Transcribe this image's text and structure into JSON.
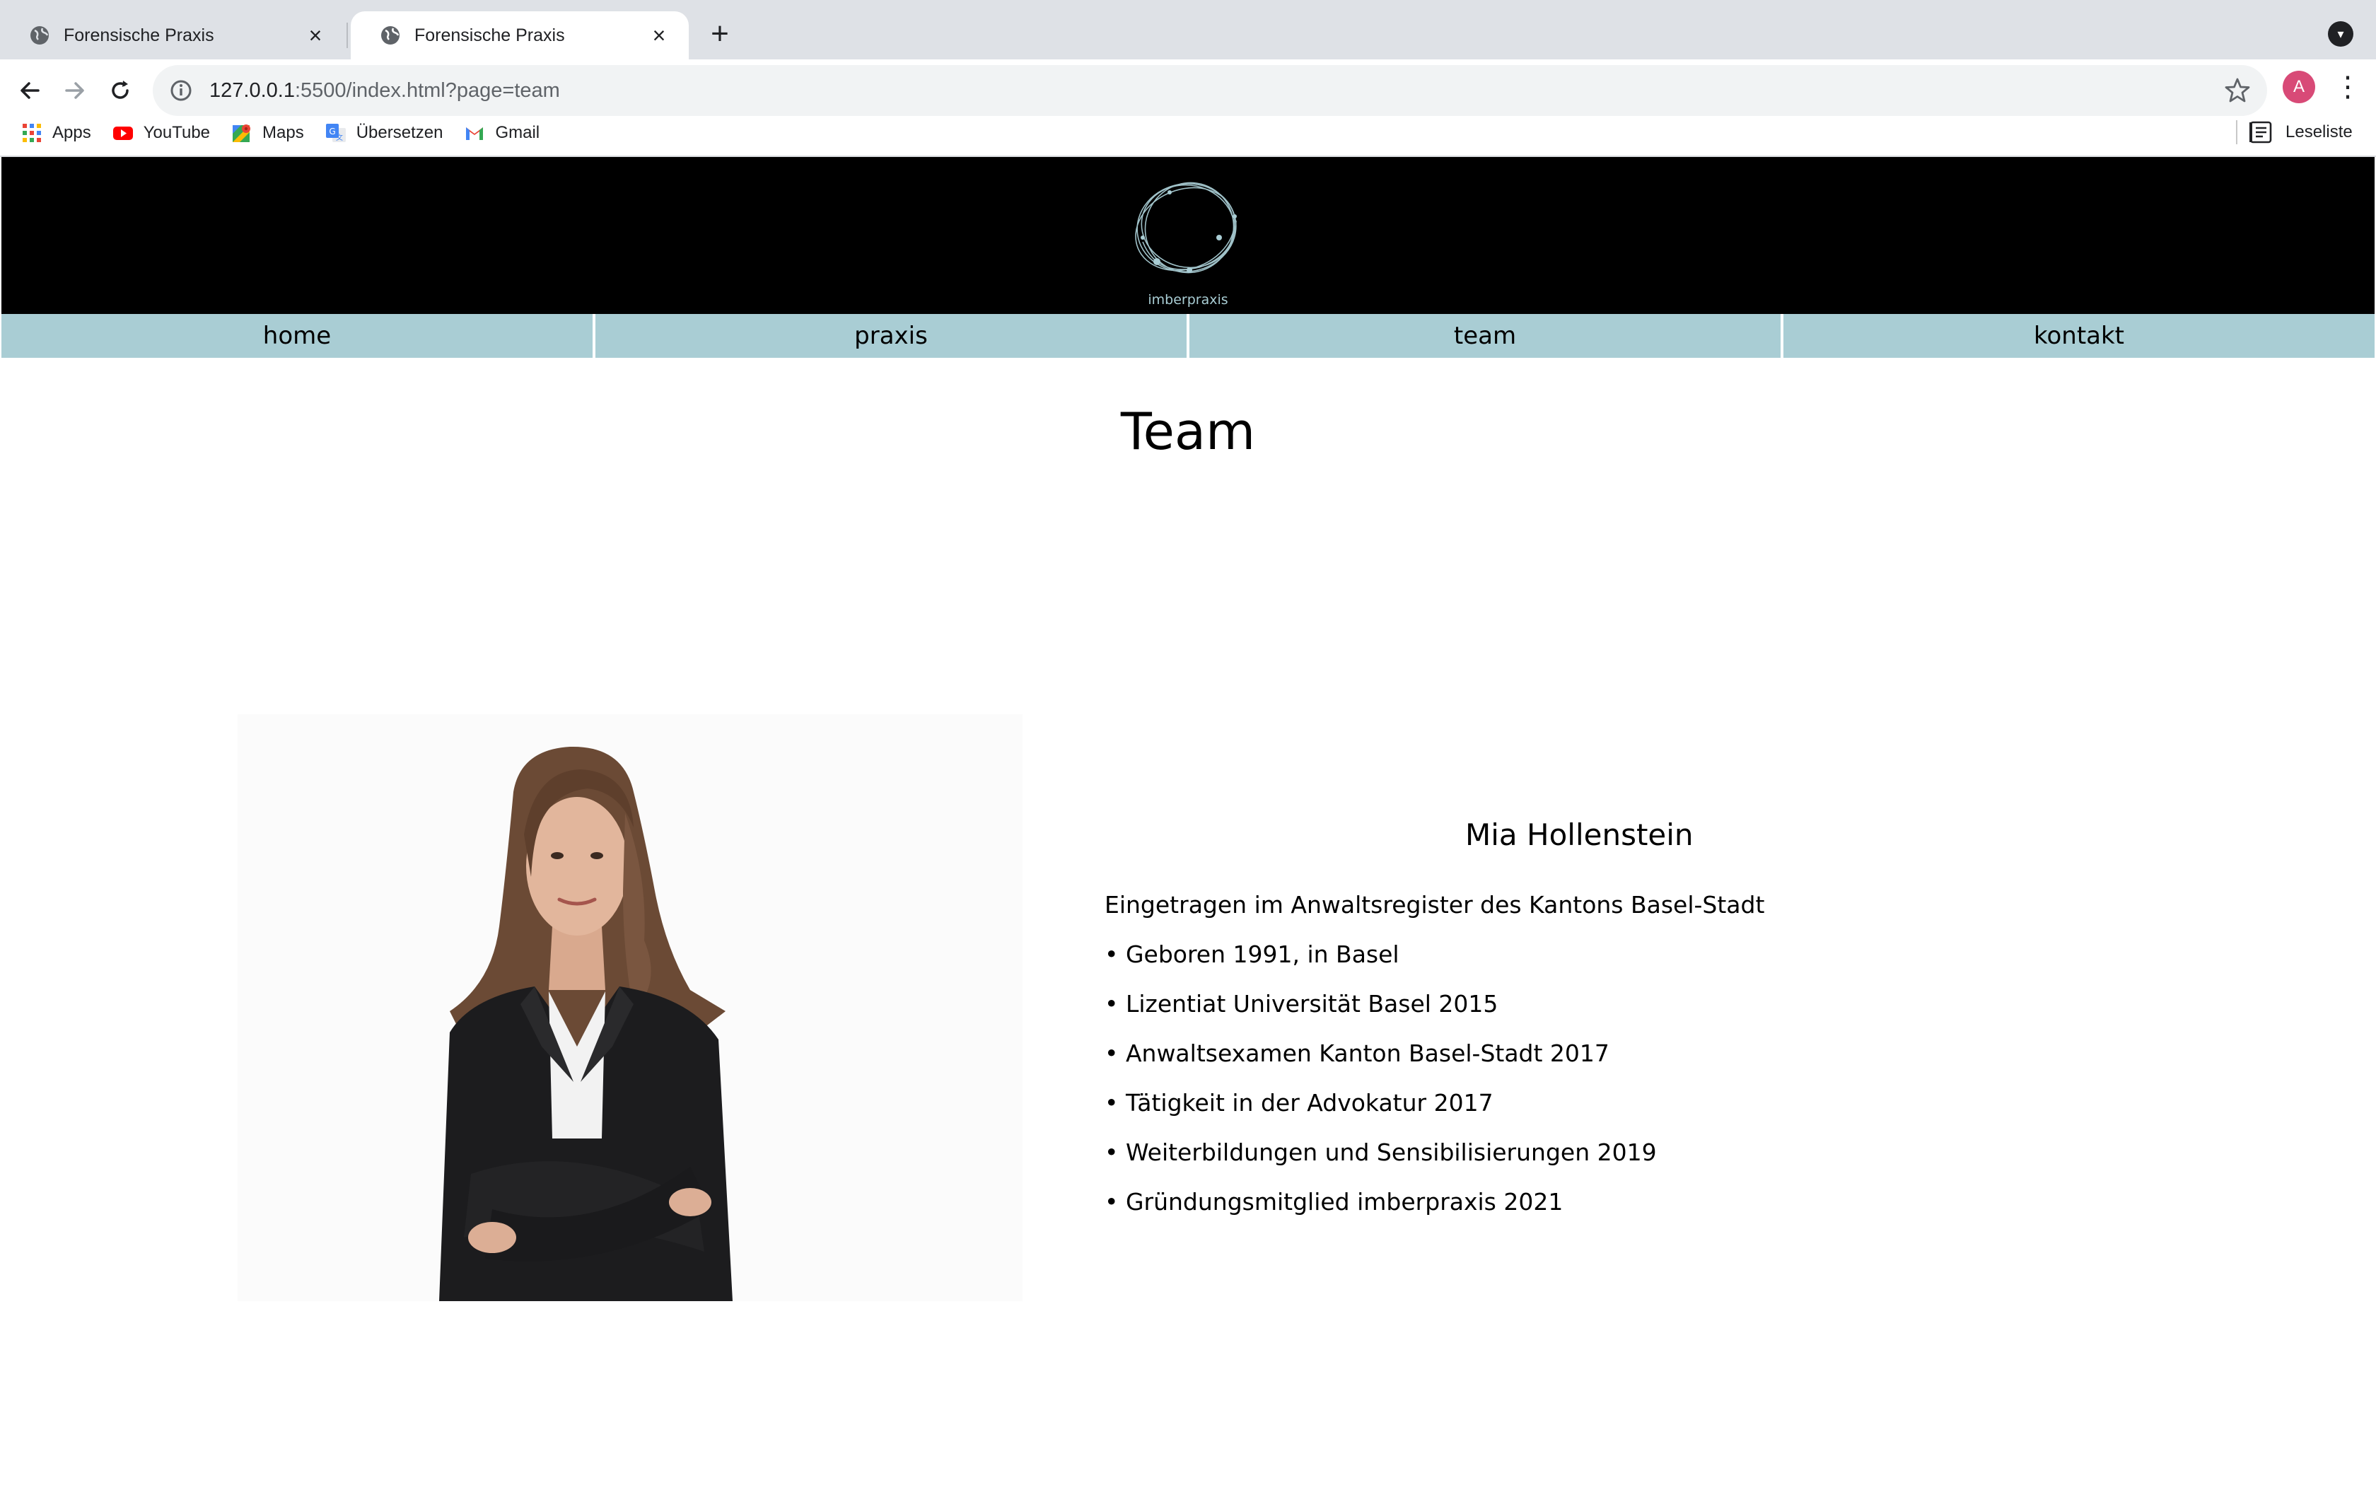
{
  "browser": {
    "tabs": [
      {
        "title": "Forensische Praxis",
        "active": false
      },
      {
        "title": "Forensische Praxis",
        "active": true
      }
    ],
    "new_tab_symbol": "+",
    "url_host": "127.0.0.1",
    "url_rest": ":5500/index.html?page=team",
    "avatar_initial": "A",
    "bookmarks": [
      {
        "label": "Apps",
        "icon": "apps-grid-icon"
      },
      {
        "label": "YouTube",
        "icon": "youtube-icon"
      },
      {
        "label": "Maps",
        "icon": "maps-icon"
      },
      {
        "label": "Übersetzen",
        "icon": "translate-icon"
      },
      {
        "label": "Gmail",
        "icon": "gmail-icon"
      }
    ],
    "reading_list": "Leseliste"
  },
  "site": {
    "logo_text": "imberpraxis",
    "nav": [
      "home",
      "praxis",
      "team",
      "kontakt"
    ],
    "page_title": "Team",
    "member": {
      "name": "Mia Hollenstein",
      "lines": [
        "Eingetragen im Anwaltsregister des Kantons Basel-Stadt",
        "• Geboren 1991, in Basel",
        "• Lizentiat Universität Basel 2015",
        "• Anwaltsexamen Kanton Basel-Stadt 2017",
        "• Tätigkeit in der Advokatur 2017",
        "• Weiterbildungen und Sensibilisierungen 2019",
        "• Gründungsmitglied imberpraxis 2021"
      ]
    }
  },
  "colors": {
    "nav_bg": "#a9cdd4",
    "header_bg": "#000000",
    "tabstrip_bg": "#dee1e6",
    "logo_stroke": "#a9cdd4"
  }
}
